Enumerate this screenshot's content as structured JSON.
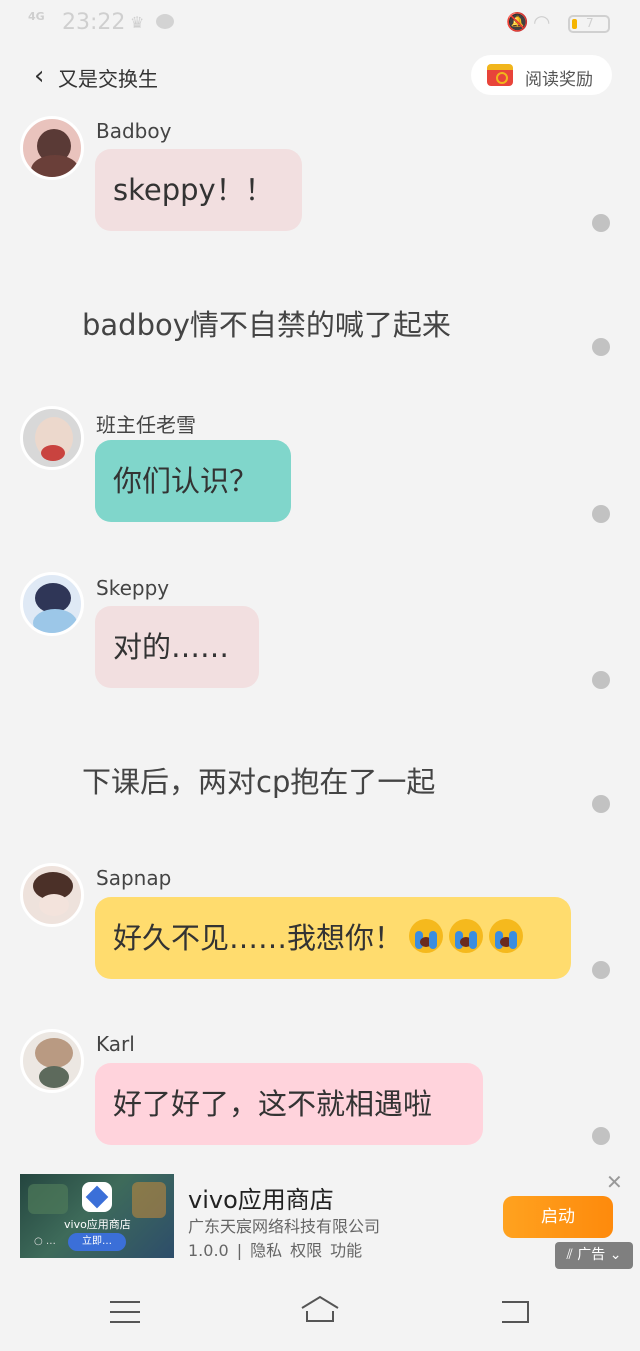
{
  "status": {
    "signal": "4G",
    "time": "23:22",
    "battery": "7"
  },
  "header": {
    "back_icon": "chevron-left-icon",
    "title": "又是交换生",
    "reward_label": "阅读奖励"
  },
  "messages": [
    {
      "kind": "chat",
      "name": "Badboy",
      "text": "skeppy！！",
      "bubble_color": "#f2dfe0"
    },
    {
      "kind": "narration",
      "text": "badboy情不自禁的喊了起来"
    },
    {
      "kind": "chat",
      "name": "班主任老雪",
      "text": "你们认识？",
      "bubble_color": "#80d6cb"
    },
    {
      "kind": "chat",
      "name": "Skeppy",
      "text": "对的……",
      "bubble_color": "#f2dfe0"
    },
    {
      "kind": "narration",
      "text": "下课后，两对cp抱在了一起"
    },
    {
      "kind": "chat",
      "name": "Sapnap",
      "text": "好久不见……我想你！",
      "emoji": "loudly-crying-face",
      "emoji_count": 3,
      "bubble_color": "#ffdc6e"
    },
    {
      "kind": "chat",
      "name": "Karl",
      "text": "好了好了，这不就相遇啦",
      "bubble_color": "#ffd3dc"
    }
  ],
  "ad": {
    "thumb_app_name": "vivo应用商店",
    "thumb_button": "立即…",
    "thumb_side": "○ …",
    "title": "vivo应用商店",
    "company": "广东天宸网络科技有限公司",
    "version": "1.0.0",
    "separator": "|",
    "privacy": "隐私",
    "permissions": "权限",
    "features": "功能",
    "launch_label": "启动",
    "tag_label": "广告",
    "accent": "#fe8a0c"
  },
  "navbar": {
    "menu_icon": "menu-icon",
    "home_icon": "home-icon",
    "back_icon": "back-icon"
  }
}
